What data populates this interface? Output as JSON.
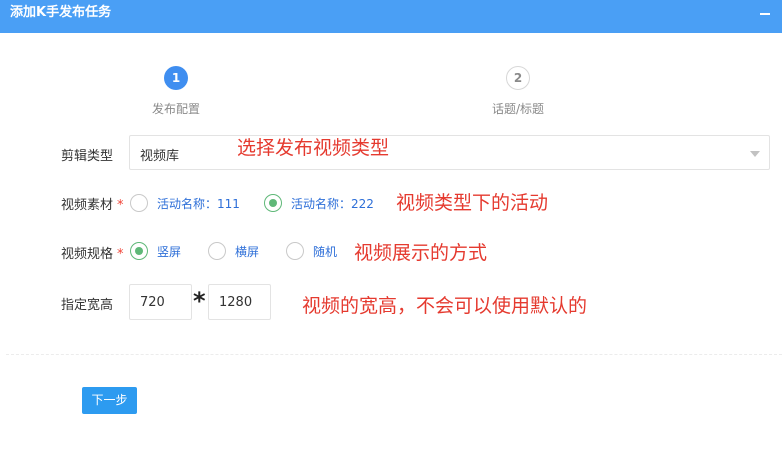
{
  "window": {
    "title": "添加K手发布任务"
  },
  "steps": [
    {
      "number": "1",
      "label": "发布配置"
    },
    {
      "number": "2",
      "label": "话题/标题"
    }
  ],
  "form": {
    "clip_type": {
      "label": "剪辑类型",
      "value": "视频库"
    },
    "material": {
      "label": "视频素材",
      "required_mark": "*",
      "options": [
        {
          "label": "活动名称：111",
          "checked": false
        },
        {
          "label": "活动名称：222",
          "checked": true
        }
      ]
    },
    "spec": {
      "label": "视频规格",
      "required_mark": "*",
      "options": [
        {
          "label": "竖屏",
          "checked": true
        },
        {
          "label": "横屏",
          "checked": false
        },
        {
          "label": "随机",
          "checked": false
        }
      ]
    },
    "size": {
      "label": "指定宽高",
      "width": "720",
      "height": "1280",
      "separator": "*"
    }
  },
  "annotations": {
    "clip_type": "选择发布视频类型",
    "material": "视频类型下的活动",
    "spec": "视频展示的方式",
    "size": "视频的宽高，不会可以使用默认的"
  },
  "buttons": {
    "next": "下一步"
  },
  "colors": {
    "titlebar": "#4a9ff5",
    "accent": "#5fb878",
    "primary": "#2d9bf0",
    "annotation": "#e53a2f"
  }
}
